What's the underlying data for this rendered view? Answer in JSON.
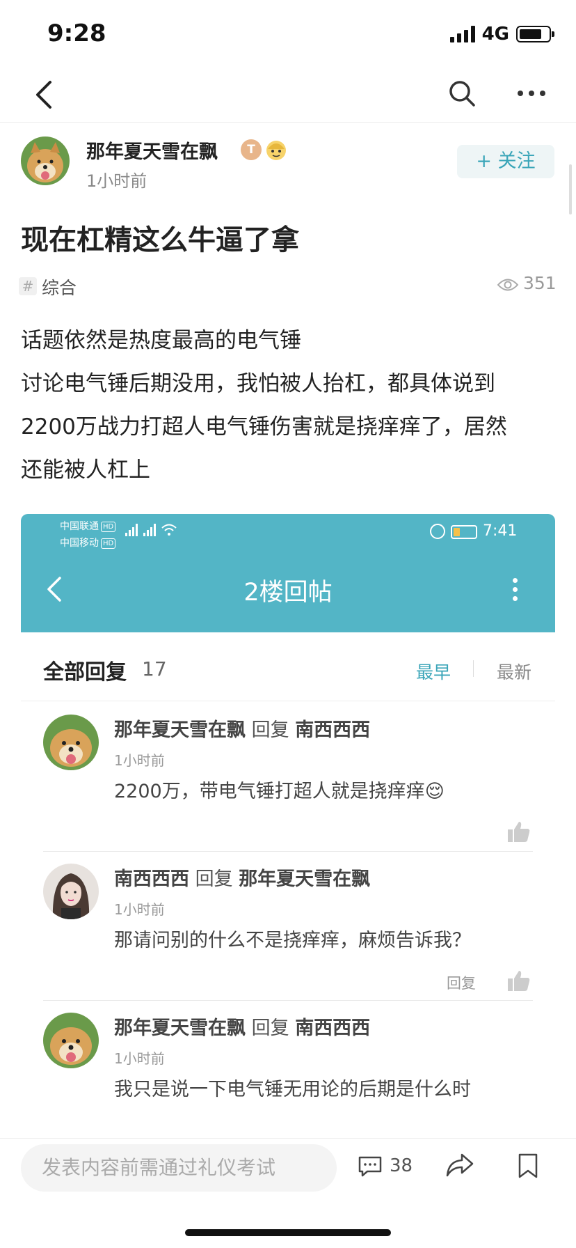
{
  "status_bar": {
    "time": "9:28",
    "network": "4G"
  },
  "nav": {
    "back_icon": "chevron-left-icon",
    "search_icon": "search-icon",
    "more_icon": "more-icon"
  },
  "post": {
    "author": {
      "name": "那年夏天雪在飘",
      "level_badge": "T",
      "time": "1小时前"
    },
    "follow_label": "+ 关注",
    "title": "现在杠精这么牛逼了拿",
    "tag": "综合",
    "views": "351",
    "body": [
      "话题依然是热度最高的电气锤",
      "讨论电气锤后期没用，我怕被人抬杠，都具体说到",
      "2200万战力打超人电气锤伤害就是挠痒痒了，居然",
      "还能被人杠上"
    ]
  },
  "screenshot": {
    "status": {
      "carrier1": "中国联通",
      "carrier2": "中国移动",
      "hd": "HD",
      "time": "7:41"
    },
    "header_title": "2楼回帖",
    "all_replies_label": "全部回复",
    "reply_count": "17",
    "sort_earliest": "最早",
    "sort_newest": "最新",
    "reply_word": "回复",
    "replies": [
      {
        "author": "那年夏天雪在飘",
        "target": "南西西西",
        "time": "1小时前",
        "text": "2200万，带电气锤打超人就是挠痒痒😌"
      },
      {
        "author": "南西西西",
        "target": "那年夏天雪在飘",
        "time": "1小时前",
        "text": "那请问别的什么不是挠痒痒，麻烦告诉我？",
        "reply_button": "回复"
      },
      {
        "author": "那年夏天雪在飘",
        "target": "南西西西",
        "time": "1小时前",
        "text": "我只是说一下电气锤无用论的后期是什么时"
      }
    ]
  },
  "bottom_bar": {
    "input_placeholder": "发表内容前需通过礼仪考试",
    "comment_count": "38"
  },
  "colors": {
    "accent": "#3aa5b8",
    "header_teal": "#53b5c6"
  }
}
